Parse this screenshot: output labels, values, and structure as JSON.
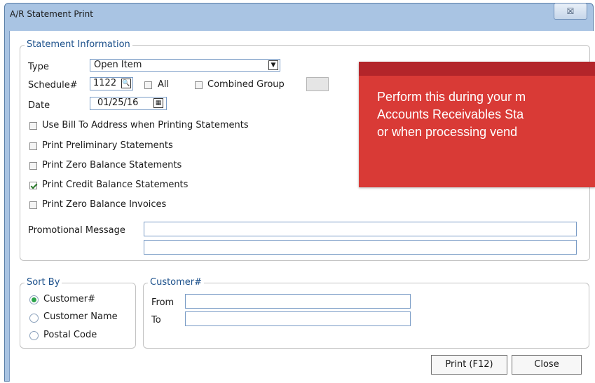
{
  "window": {
    "title": "A/R Statement Print",
    "close_glyph": "☒"
  },
  "statement_info": {
    "legend": "Statement Information",
    "type_label": "Type",
    "type_value": "Open Item",
    "schedule_label": "Schedule#",
    "schedule_value": "1122",
    "all_label": "All",
    "combined_group_label": "Combined Group",
    "date_label": "Date",
    "date_value": "01/25/16",
    "options": [
      {
        "label": "Use Bill To Address when Printing Statements",
        "checked": false
      },
      {
        "label": "Print Preliminary Statements",
        "checked": false
      },
      {
        "label": "Print Zero Balance Statements",
        "checked": false
      },
      {
        "label": "Print Credit Balance Statements",
        "checked": true
      },
      {
        "label": "Print Zero Balance Invoices",
        "checked": false
      }
    ],
    "promo_label": "Promotional Message",
    "promo_line1": "",
    "promo_line2": ""
  },
  "sort_by": {
    "legend": "Sort By",
    "options": [
      {
        "label": "Customer#",
        "selected": true
      },
      {
        "label": "Customer Name",
        "selected": false
      },
      {
        "label": "Postal Code",
        "selected": false
      }
    ]
  },
  "customer_range": {
    "legend": "Customer#",
    "from_label": "From",
    "to_label": "To",
    "from_value": "",
    "to_value": ""
  },
  "buttons": {
    "print": "Print (F12)",
    "close": "Close"
  },
  "callout": {
    "lines": [
      "Perform this during your m",
      "Accounts Receivables Sta",
      "or when processing vend"
    ]
  },
  "colors": {
    "accent": "#1a4f8a",
    "callout_red": "#d93a36",
    "callout_dark": "#b3252a",
    "titlebar": "#a9c4e3"
  }
}
